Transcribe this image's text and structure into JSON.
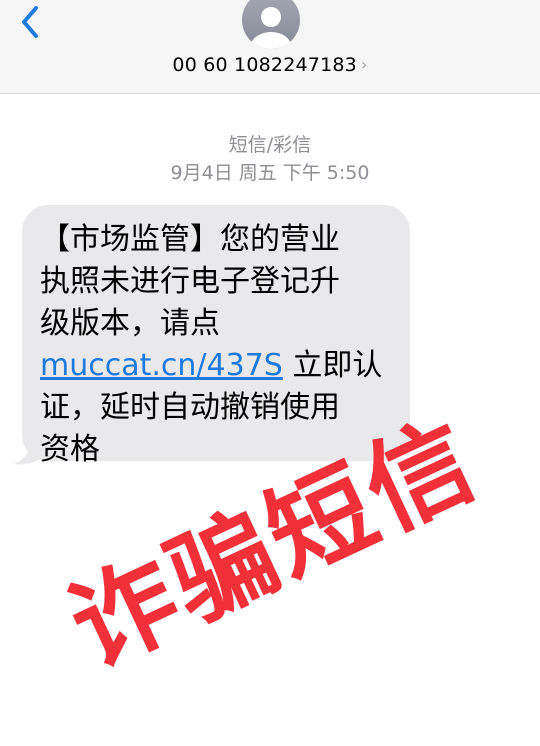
{
  "header": {
    "back_icon": "chevron-left-icon",
    "avatar_icon": "person-avatar-icon",
    "contact_number": "00 60 1082247183",
    "contact_chevron": "›"
  },
  "thread": {
    "message_type": "短信/彩信",
    "timestamp": "9月4日 周五 下午 5:50"
  },
  "message": {
    "line1": "【市场监管】您的营业",
    "line2": "执照未进行电子登记升",
    "line3": "级版本，请点",
    "link": "muccat.cn/437S",
    "line4_suffix": " 立即认",
    "line5": "证，延时自动撤销使用",
    "line6": "资格"
  },
  "overlay": {
    "stamp_text": "诈骗短信",
    "stamp_color": "#f2303a"
  },
  "colors": {
    "header_bg": "#f6f6f7",
    "bubble_bg": "#e9e9eb",
    "link": "#1f7ae0",
    "accent": "#1f7ae0"
  }
}
